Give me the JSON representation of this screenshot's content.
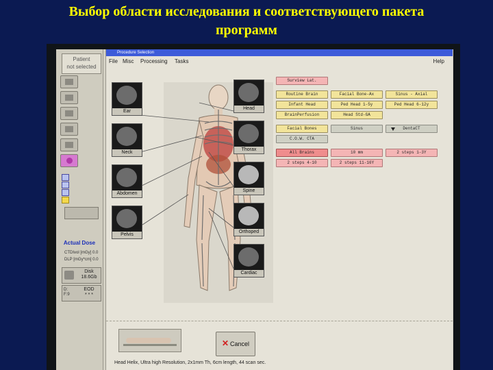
{
  "slide": {
    "title_line1": "Выбор области исследования и соответствующего пакета",
    "title_line2": "программ"
  },
  "left_panel": {
    "patient_line1": "Patient",
    "patient_line2": "not selected",
    "actual_dose_title": "Actual Dose",
    "ctdi_label": "CTDIvol [mGy]",
    "ctdi_value": "0.0",
    "dlp_label": "DLP [mGy*cm]",
    "dlp_value": "0.0",
    "disk_label": "Disk",
    "disk_value": "18.6Gb",
    "fs_label_1": "D:",
    "fs_label_2": "F:9",
    "eod_label": "EOD",
    "eod_value": "* * *"
  },
  "window": {
    "title": "Procedure Selection",
    "menu": [
      "File",
      "Misc",
      "Processing",
      "Tasks"
    ],
    "help": "Help"
  },
  "regions_left": [
    "Ear",
    "Neck",
    "Abdomen",
    "Pelvis"
  ],
  "regions_right": [
    "Head",
    "Thorax",
    "Spine",
    "Orthoped",
    "Cardiac"
  ],
  "protocols": {
    "surview": "Surview Lat.",
    "row1": [
      "Routine Brain",
      "Facial Bone-Ax",
      "Sinus - Axial"
    ],
    "row2": [
      "Infant Head",
      "Ped Head 1-5y",
      "Ped Head 6-12y"
    ],
    "row3": [
      "BrainPerfusion",
      "Head Std-GA"
    ],
    "row4": [
      "Facial Bones",
      "Sinus",
      "DentaCT"
    ],
    "row5": [
      "C.O.W. CTA"
    ],
    "row6": [
      "All Brains",
      "10 mm",
      "2 steps 1-3Y"
    ],
    "row7": [
      "2 steps 4-10",
      "2 steps 11-16Y"
    ]
  },
  "bottom": {
    "cancel_label": "Cancel",
    "status_text": "Head Helix, Ultra high Resolution, 2x1mm Th, 6cm length, 44 scan sec."
  },
  "colors": {
    "slide_bg": "#0b1a52",
    "title": "#ffff00",
    "protocol_yellow": "#f2e49a",
    "protocol_red": "#ef8d8d",
    "protocol_pink": "#f4b5b5",
    "cancel_x": "#d21f1f"
  }
}
